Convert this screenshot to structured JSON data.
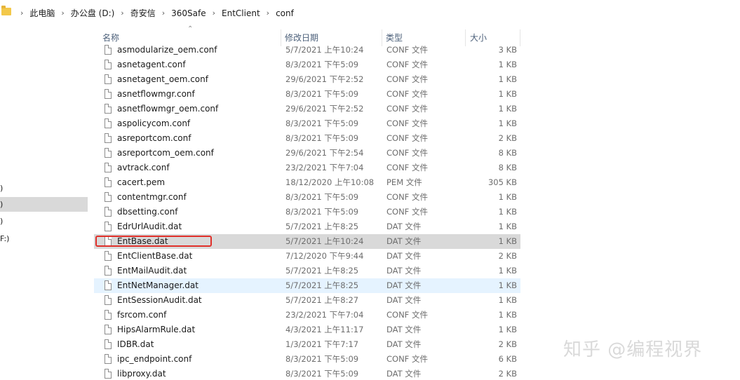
{
  "breadcrumb": [
    "此电脑",
    "办公盘 (D:)",
    "奇安信",
    "360Safe",
    "EntClient",
    "conf"
  ],
  "nav": {
    "items": [
      ")",
      ")",
      ")",
      "F:)"
    ],
    "selected_index": 1
  },
  "columns": {
    "name": "名称",
    "date": "修改日期",
    "type": "类型",
    "size": "大小"
  },
  "files": [
    {
      "name": "asmodularize_oem.conf",
      "date": "5/7/2021 上午10:24",
      "type": "CONF 文件",
      "size": "3 KB"
    },
    {
      "name": "asnetagent.conf",
      "date": "8/3/2021 下午5:09",
      "type": "CONF 文件",
      "size": "1 KB"
    },
    {
      "name": "asnetagent_oem.conf",
      "date": "29/6/2021 下午2:52",
      "type": "CONF 文件",
      "size": "1 KB"
    },
    {
      "name": "asnetflowmgr.conf",
      "date": "8/3/2021 下午5:09",
      "type": "CONF 文件",
      "size": "1 KB"
    },
    {
      "name": "asnetflowmgr_oem.conf",
      "date": "29/6/2021 下午2:52",
      "type": "CONF 文件",
      "size": "1 KB"
    },
    {
      "name": "aspolicycom.conf",
      "date": "8/3/2021 下午5:09",
      "type": "CONF 文件",
      "size": "1 KB"
    },
    {
      "name": "asreportcom.conf",
      "date": "8/3/2021 下午5:09",
      "type": "CONF 文件",
      "size": "2 KB"
    },
    {
      "name": "asreportcom_oem.conf",
      "date": "29/6/2021 下午2:54",
      "type": "CONF 文件",
      "size": "8 KB"
    },
    {
      "name": "avtrack.conf",
      "date": "23/2/2021 下午7:04",
      "type": "CONF 文件",
      "size": "8 KB"
    },
    {
      "name": "cacert.pem",
      "date": "18/12/2020 上午10:08",
      "type": "PEM 文件",
      "size": "305 KB"
    },
    {
      "name": "contentmgr.conf",
      "date": "8/3/2021 下午5:09",
      "type": "CONF 文件",
      "size": "1 KB"
    },
    {
      "name": "dbsetting.conf",
      "date": "8/3/2021 下午5:09",
      "type": "CONF 文件",
      "size": "1 KB"
    },
    {
      "name": "EdrUrlAudit.dat",
      "date": "5/7/2021 上午8:25",
      "type": "DAT 文件",
      "size": "1 KB"
    },
    {
      "name": "EntBase.dat",
      "date": "5/7/2021 上午10:24",
      "type": "DAT 文件",
      "size": "1 KB",
      "selected": true
    },
    {
      "name": "EntClientBase.dat",
      "date": "7/12/2020 下午9:44",
      "type": "DAT 文件",
      "size": "2 KB"
    },
    {
      "name": "EntMailAudit.dat",
      "date": "5/7/2021 上午8:25",
      "type": "DAT 文件",
      "size": "1 KB"
    },
    {
      "name": "EntNetManager.dat",
      "date": "5/7/2021 上午8:25",
      "type": "DAT 文件",
      "size": "1 KB",
      "hover": true
    },
    {
      "name": "EntSessionAudit.dat",
      "date": "5/7/2021 上午8:27",
      "type": "DAT 文件",
      "size": "1 KB"
    },
    {
      "name": "fsrcom.conf",
      "date": "23/2/2021 下午7:04",
      "type": "CONF 文件",
      "size": "1 KB"
    },
    {
      "name": "HipsAlarmRule.dat",
      "date": "4/3/2021 上午11:17",
      "type": "DAT 文件",
      "size": "1 KB"
    },
    {
      "name": "IDBR.dat",
      "date": "1/3/2021 下午7:17",
      "type": "DAT 文件",
      "size": "2 KB"
    },
    {
      "name": "ipc_endpoint.conf",
      "date": "8/3/2021 下午5:09",
      "type": "CONF 文件",
      "size": "6 KB"
    },
    {
      "name": "libproxy.dat",
      "date": "8/3/2021 下午5:09",
      "type": "DAT 文件",
      "size": "2 KB"
    }
  ],
  "watermark": "知乎 @编程视界",
  "colors": {
    "selected_row": "#d9d9d9",
    "hover_row": "#e5f3ff",
    "highlight_box": "#e0302a",
    "header_text": "#4c607a"
  }
}
